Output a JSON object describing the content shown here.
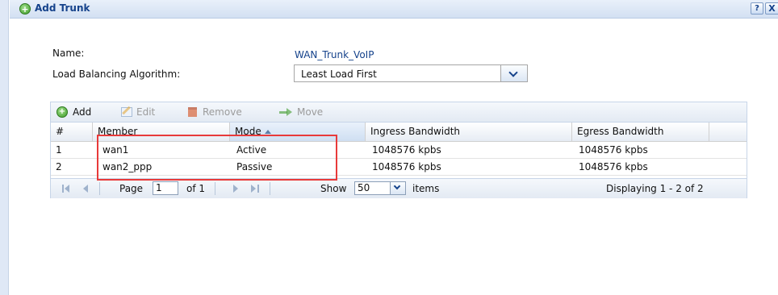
{
  "dialog": {
    "title": "Add Trunk",
    "help_label": "?",
    "close_label": "X"
  },
  "form": {
    "name_label": "Name:",
    "name_value": "WAN_Trunk_VoIP",
    "algorithm_label": "Load Balancing Algorithm:",
    "algorithm_value": "Least Load First"
  },
  "toolbar": {
    "add_label": "Add",
    "edit_label": "Edit",
    "remove_label": "Remove",
    "move_label": "Move"
  },
  "table": {
    "columns": [
      "#",
      "Member",
      "Mode",
      "Ingress Bandwidth",
      "Egress Bandwidth"
    ],
    "sorted_column": "Mode",
    "rows": [
      {
        "index": "1",
        "member": "wan1",
        "mode": "Active",
        "ingress": "1048576 kpbs",
        "egress": "1048576 kpbs"
      },
      {
        "index": "2",
        "member": "wan2_ppp",
        "mode": "Passive",
        "ingress": "1048576 kpbs",
        "egress": "1048576 kpbs"
      }
    ]
  },
  "pager": {
    "page_label": "Page",
    "page_value": "1",
    "of_label": "of 1",
    "show_label": "Show",
    "show_value": "50",
    "items_label": "items",
    "status": "Displaying 1 - 2 of 2"
  },
  "colors": {
    "title_text": "#15428b",
    "highlight_border": "#e83a3a"
  }
}
